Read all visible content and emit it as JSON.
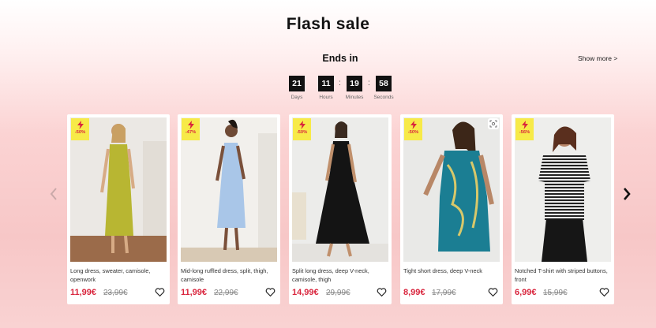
{
  "header": {
    "title": "Flash sale",
    "ends_in": "Ends in",
    "show_more": "Show more >"
  },
  "countdown": [
    {
      "value": "21",
      "label": "Days"
    },
    {
      "value": "11",
      "label": "Hours"
    },
    {
      "value": "19",
      "label": "Minutes"
    },
    {
      "value": "58",
      "label": "Seconds"
    }
  ],
  "countdown_separator": ":",
  "carousel": {
    "prev_icon": "chevron-left-icon",
    "next_icon": "chevron-right-icon"
  },
  "products": [
    {
      "discount": "-50%",
      "name": "Long dress, sweater, camisole, openwork",
      "price": "11,99€",
      "old_price": "23,99€"
    },
    {
      "discount": "-47%",
      "name": "Mid-long ruffled dress, split, thigh, camisole",
      "price": "11,99€",
      "old_price": "22,99€"
    },
    {
      "discount": "-50%",
      "name": "Split long dress, deep V-neck, camisole, thigh",
      "price": "14,99€",
      "old_price": "29,99€"
    },
    {
      "discount": "-50%",
      "name": "Tight short dress, deep V-neck",
      "price": "8,99€",
      "old_price": "17,99€"
    },
    {
      "discount": "-56%",
      "name": "Notched T-shirt with striped buttons, front",
      "price": "6,99€",
      "old_price": "15,99€"
    }
  ],
  "colors": {
    "price": "#d9253d",
    "badge": "#f7ea48",
    "countdown_box": "#111111"
  }
}
